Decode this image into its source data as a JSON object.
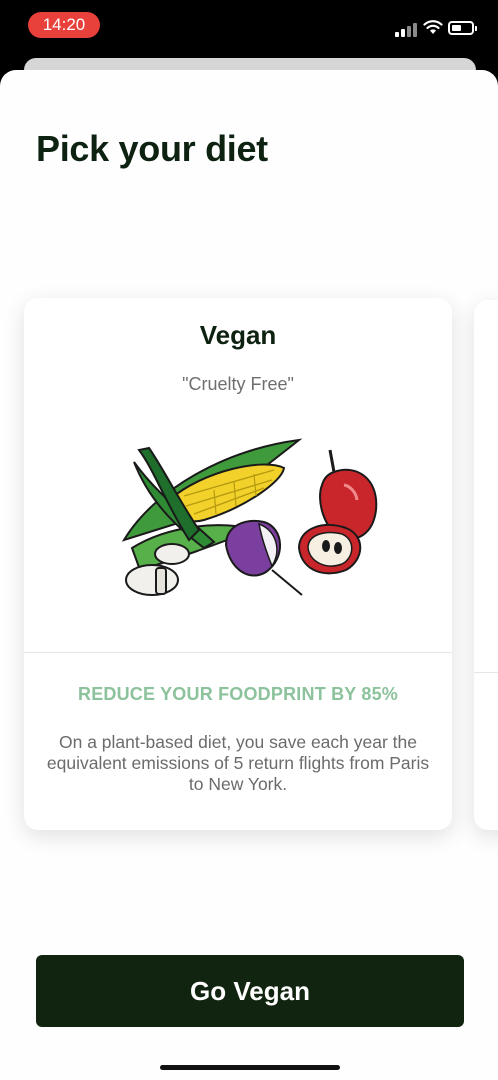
{
  "status_bar": {
    "time": "14:20",
    "signal_icon": "cellular-signal-icon",
    "wifi_icon": "wifi-icon",
    "battery_icon": "battery-icon",
    "colors": {
      "time_pill": "#e8413b"
    }
  },
  "page": {
    "title": "Pick your diet"
  },
  "diet_card": {
    "title": "Vegan",
    "subtitle": "\"Cruelty Free\"",
    "illustration_icon": "vegetables-illustration",
    "footprint": "REDUCE YOUR FOODPRINT BY 85%",
    "description": "On a plant-based diet, you save each year the equivalent emissions of 5 return flights from Paris to New York.",
    "colors": {
      "footprint": "#8cc29c"
    }
  },
  "cta": {
    "label": "Go Vegan",
    "color": "#10240f"
  }
}
